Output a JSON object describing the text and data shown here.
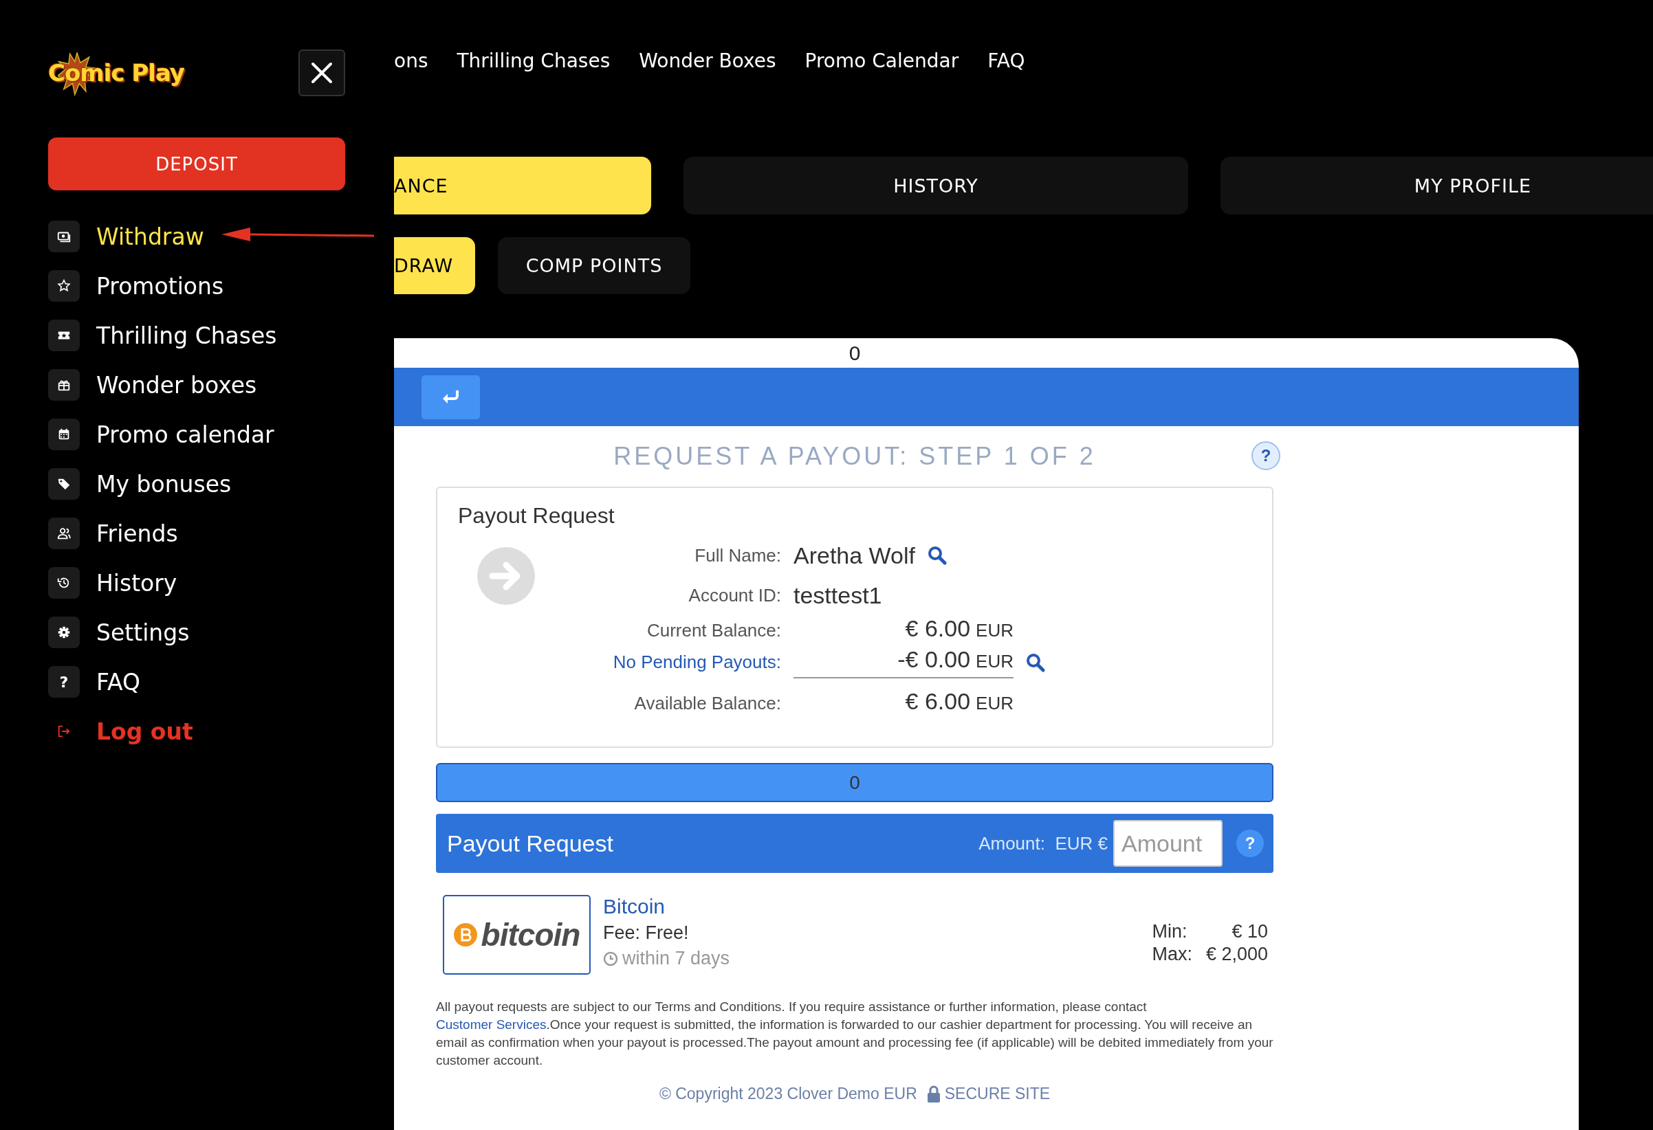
{
  "logo": {
    "text": "Comic Play"
  },
  "sidebar": {
    "deposit": "DEPOSIT",
    "items": [
      {
        "label": "Withdraw",
        "selected": true,
        "kind": "item"
      },
      {
        "label": "Promotions",
        "selected": false,
        "kind": "item"
      },
      {
        "label": "Thrilling Chases",
        "selected": false,
        "kind": "item"
      },
      {
        "label": "Wonder boxes",
        "selected": false,
        "kind": "item"
      },
      {
        "label": "Promo calendar",
        "selected": false,
        "kind": "item"
      },
      {
        "label": "My bonuses",
        "selected": false,
        "kind": "item"
      },
      {
        "label": "Friends",
        "selected": false,
        "kind": "item"
      },
      {
        "label": "History",
        "selected": false,
        "kind": "item"
      },
      {
        "label": "Settings",
        "selected": false,
        "kind": "item"
      },
      {
        "label": "FAQ",
        "icon_text": "?",
        "selected": false,
        "kind": "item"
      },
      {
        "label": "Log out",
        "selected": false,
        "kind": "logout"
      }
    ]
  },
  "top_nav": [
    "ons",
    "Thrilling Chases",
    "Wonder Boxes",
    "Promo Calendar",
    "FAQ"
  ],
  "tabs": [
    {
      "label": "ANCE",
      "selected": true
    },
    {
      "label": "HISTORY",
      "selected": false
    },
    {
      "label": "MY PROFILE",
      "selected": false
    }
  ],
  "sub_tabs": [
    {
      "label": "DRAW",
      "selected": true
    },
    {
      "label": "COMP POINTS",
      "selected": false
    }
  ],
  "cashier": {
    "top_counter": "0",
    "title": "REQUEST A PAYOUT: STEP 1 OF 2",
    "help": "?",
    "summary": {
      "heading": "Payout Request",
      "full_name_label": "Full Name:",
      "full_name": "Aretha Wolf",
      "account_label": "Account ID:",
      "account_id": "testtest1",
      "balances": [
        {
          "label": "Current Balance:",
          "amount": "€ 6.00",
          "currency": "EUR",
          "kind": "plain"
        },
        {
          "label": "No Pending Payouts:",
          "amount": "-€ 0.00",
          "currency": "EUR",
          "kind": "link"
        },
        {
          "label": "Available Balance:",
          "amount": "€ 6.00",
          "currency": "EUR",
          "kind": "plain"
        }
      ]
    },
    "counter_bar": "0",
    "request_bar": {
      "title": "Payout Request",
      "amount_label": "Amount:",
      "currency": "EUR €",
      "placeholder": "Amount",
      "help": "?"
    },
    "method": {
      "logo_text": "bitcoin",
      "name": "Bitcoin",
      "fee": "Fee: Free!",
      "time": "within 7 days",
      "min_label": "Min:",
      "min": "€ 10",
      "max_label": "Max:",
      "max": "€ 2,000"
    },
    "disclaimer": {
      "before": "All payout requests are subject to our Terms and Conditions. If you require assistance or further information, please contact ",
      "link": "Customer Services",
      "after": ".Once your request is submitted, the information is forwarded to our cashier department for processing. You will receive an email as confirmation when your payout is processed.The payout amount and processing fee (if applicable) will be debited immediately from your customer account."
    },
    "footer": {
      "copyright": "© Copyright 2023 Clover Demo EUR",
      "secure": "SECURE SITE"
    }
  }
}
